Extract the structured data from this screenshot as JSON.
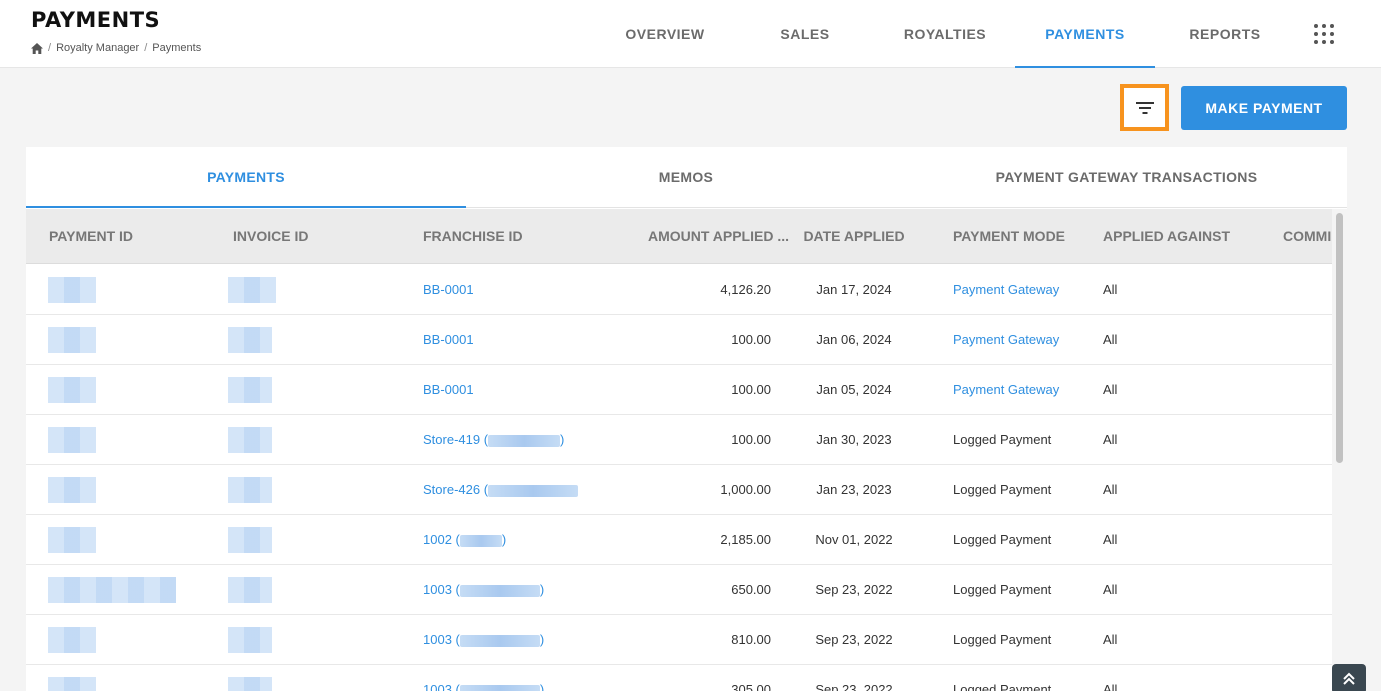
{
  "header": {
    "title": "PAYMENTS",
    "breadcrumb": [
      "Royalty Manager",
      "Payments"
    ]
  },
  "nav": {
    "tabs": [
      {
        "label": "OVERVIEW"
      },
      {
        "label": "SALES"
      },
      {
        "label": "ROYALTIES"
      },
      {
        "label": "PAYMENTS",
        "active": true
      },
      {
        "label": "REPORTS"
      }
    ],
    "apps_icon": "grid-icon"
  },
  "toolbar": {
    "filter_icon": "filter-icon",
    "make_payment_label": "MAKE PAYMENT"
  },
  "subtabs": [
    {
      "label": "PAYMENTS",
      "active": true
    },
    {
      "label": "MEMOS"
    },
    {
      "label": "PAYMENT GATEWAY TRANSACTIONS"
    }
  ],
  "table": {
    "columns": [
      "PAYMENT ID",
      "INVOICE ID",
      "FRANCHISE ID",
      "AMOUNT APPLIED ...",
      "DATE APPLIED",
      "PAYMENT MODE",
      "APPLIED AGAINST",
      "COMMI"
    ],
    "rows": [
      {
        "franchise": "BB-0001",
        "amount": "4,126.20",
        "date": "Jan 17, 2024",
        "mode": "Payment Gateway",
        "against": "All"
      },
      {
        "franchise": "BB-0001",
        "amount": "100.00",
        "date": "Jan 06, 2024",
        "mode": "Payment Gateway",
        "against": "All"
      },
      {
        "franchise": "BB-0001",
        "amount": "100.00",
        "date": "Jan 05, 2024",
        "mode": "Payment Gateway",
        "against": "All"
      },
      {
        "franchise": "Store-419 (",
        "suffix": ")",
        "amount": "100.00",
        "date": "Jan 30, 2023",
        "mode": "Logged Payment",
        "against": "All"
      },
      {
        "franchise": "Store-426 (",
        "suffix": "",
        "amount": "1,000.00",
        "date": "Jan 23, 2023",
        "mode": "Logged Payment",
        "against": "All"
      },
      {
        "franchise": "1002 (",
        "suffix": ")",
        "amount": "2,185.00",
        "date": "Nov 01, 2022",
        "mode": "Logged Payment",
        "against": "All"
      },
      {
        "franchise": "1003 (",
        "suffix": ")",
        "amount": "650.00",
        "date": "Sep 23, 2022",
        "mode": "Logged Payment",
        "against": "All"
      },
      {
        "franchise": "1003 (",
        "suffix": ")",
        "amount": "810.00",
        "date": "Sep 23, 2022",
        "mode": "Logged Payment",
        "against": "All"
      },
      {
        "franchise": "1003 (",
        "suffix": ")",
        "amount": "305.00",
        "date": "Sep 23, 2022",
        "mode": "Logged Payment",
        "against": "All"
      }
    ]
  },
  "colors": {
    "accent": "#2f8fe0",
    "filter_highlight": "#f7931e"
  }
}
